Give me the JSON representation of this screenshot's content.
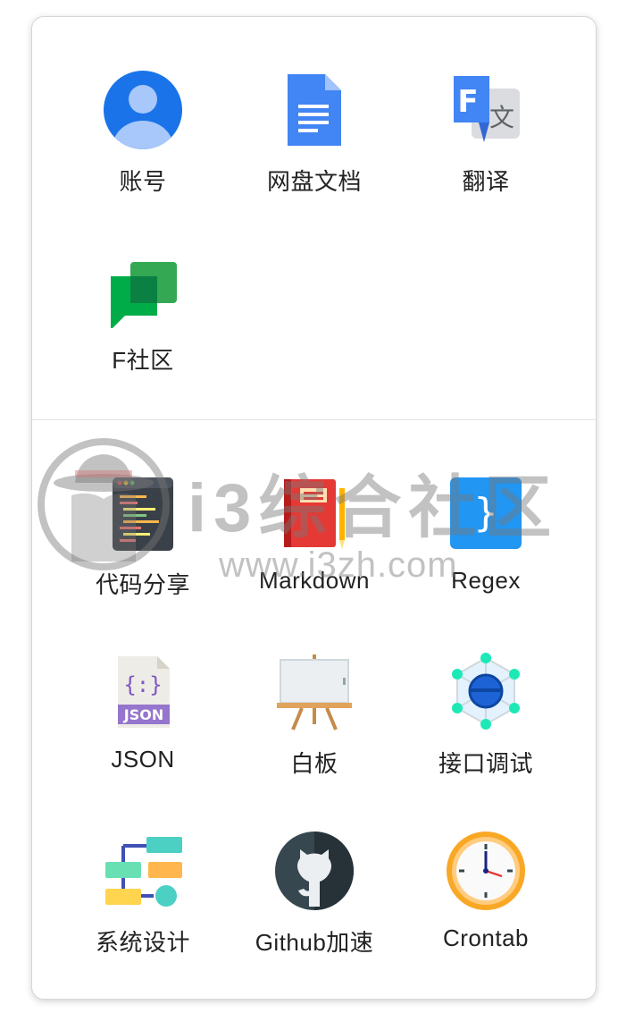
{
  "apps_group_1": [
    {
      "label": "账号",
      "icon": "account-icon"
    },
    {
      "label": "网盘文档",
      "icon": "docs-icon"
    },
    {
      "label": "翻译",
      "icon": "translate-icon"
    },
    {
      "label": "F社区",
      "icon": "chat-icon"
    }
  ],
  "apps_group_2": [
    {
      "label": "代码分享",
      "icon": "code-share-icon"
    },
    {
      "label": "Markdown",
      "icon": "markdown-icon"
    },
    {
      "label": "Regex",
      "icon": "regex-icon"
    },
    {
      "label": "JSON",
      "icon": "json-icon"
    },
    {
      "label": "白板",
      "icon": "whiteboard-icon"
    },
    {
      "label": "接口调试",
      "icon": "api-debug-icon"
    },
    {
      "label": "系统设计",
      "icon": "system-design-icon"
    },
    {
      "label": "Github加速",
      "icon": "github-icon"
    },
    {
      "label": "Crontab",
      "icon": "clock-icon"
    }
  ],
  "watermark": {
    "text": "i3综合社区",
    "url": "www.i3zh.com"
  },
  "colors": {
    "google_blue": "#1a73e8",
    "chat_green": "#00ac47",
    "regex_blue": "#2196f3",
    "markdown_red": "#e53935"
  }
}
